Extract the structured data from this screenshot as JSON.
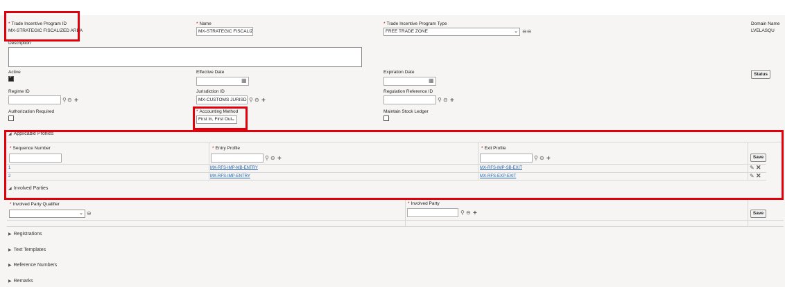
{
  "fields": {
    "program_id": {
      "label": "Trade Incentive Program ID",
      "value": "MX-STRATEGIC FISCALIZED AREA"
    },
    "name": {
      "label": "Name",
      "value": "MX-STRATEGIC FISCALIZE"
    },
    "program_type": {
      "label": "Trade Incentive Program Type",
      "value": "FREE TRADE ZONE"
    },
    "domain_name": {
      "label": "Domain Name",
      "value": "LVELASQU"
    },
    "description": {
      "label": "Description",
      "value": ""
    },
    "active": {
      "label": "Active",
      "checked": true
    },
    "effective_date": {
      "label": "Effective Date",
      "value": ""
    },
    "expiration_date": {
      "label": "Expiration Date",
      "value": ""
    },
    "status_button": "Status",
    "regime_id": {
      "label": "Regime ID",
      "value": ""
    },
    "jurisdiction_id": {
      "label": "Jurisdiction ID",
      "value": "MX-CUSTOMS JURISDIC"
    },
    "regulation_reference_id": {
      "label": "Regulation Reference ID",
      "value": ""
    },
    "authorization_required": {
      "label": "Authorization Required",
      "checked": false
    },
    "accounting_method": {
      "label": "Accounting Method",
      "value": "First In, First Out"
    },
    "maintain_stock_ledger": {
      "label": "Maintain Stock Ledger",
      "checked": false
    }
  },
  "applicable_profiles": {
    "title": "Applicable Profiles",
    "columns": [
      "Sequence Number",
      "Entry Profile",
      "Exit Profile"
    ],
    "save_label": "Save",
    "rows": [
      {
        "seq": "1",
        "entry": "MX-RFS-IMP-MB-ENTRY",
        "exit": "MX-RFS-IMP-SB-EXIT"
      },
      {
        "seq": "2",
        "entry": "MX-RFS-IMP-ENTRY",
        "exit": "MX-RFS-EXP-EXIT"
      }
    ]
  },
  "involved_parties": {
    "title": "Involved Parties",
    "columns": [
      "Involved Party Qualifier",
      "Involved Party"
    ],
    "save_label": "Save"
  },
  "collapsed_sections": [
    "Registrations",
    "Text Templates",
    "Reference Numbers",
    "Remarks"
  ],
  "colors": {
    "highlight": "#e0000b",
    "link": "#1f5fae",
    "required": "#cc0000",
    "background": "#f6f5f3"
  },
  "icons": [
    "search-icon",
    "lookup-icon",
    "add-icon",
    "calendar-icon",
    "edit-icon",
    "delete-icon",
    "chevron-down-icon",
    "triangle-right-icon",
    "triangle-down-icon"
  ]
}
